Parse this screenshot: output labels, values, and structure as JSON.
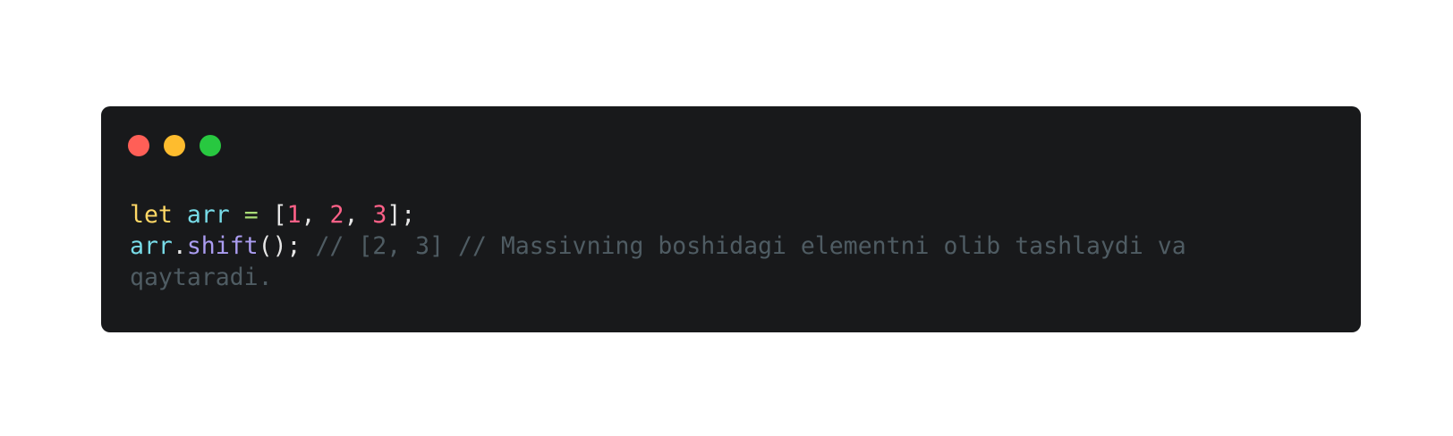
{
  "window": {
    "controls": [
      {
        "name": "close",
        "color": "#ff5f57"
      },
      {
        "name": "minimize",
        "color": "#febc2e"
      },
      {
        "name": "maximize",
        "color": "#28c840"
      }
    ]
  },
  "theme": {
    "background": "#18191b",
    "keyword": "#ffd866",
    "variable": "#78dce8",
    "operator": "#a9dc76",
    "number": "#ff6188",
    "punctuation": "#e6e6e6",
    "method": "#ab9df2",
    "comment": "#4f5c63"
  },
  "code": {
    "lines": [
      [
        {
          "text": "let",
          "type": "keyword"
        },
        {
          "text": " ",
          "type": "punctuation"
        },
        {
          "text": "arr",
          "type": "variable"
        },
        {
          "text": " ",
          "type": "punctuation"
        },
        {
          "text": "=",
          "type": "operator"
        },
        {
          "text": " [",
          "type": "punctuation"
        },
        {
          "text": "1",
          "type": "number"
        },
        {
          "text": ", ",
          "type": "punctuation"
        },
        {
          "text": "2",
          "type": "number"
        },
        {
          "text": ", ",
          "type": "punctuation"
        },
        {
          "text": "3",
          "type": "number"
        },
        {
          "text": "];",
          "type": "punctuation"
        }
      ],
      [
        {
          "text": "arr",
          "type": "variable"
        },
        {
          "text": ".",
          "type": "punctuation"
        },
        {
          "text": "shift",
          "type": "method"
        },
        {
          "text": "(); ",
          "type": "punctuation"
        },
        {
          "text": "// [2, 3] // Massivning boshidagi elementni olib tashlaydi va qaytaradi.",
          "type": "comment"
        }
      ]
    ]
  }
}
